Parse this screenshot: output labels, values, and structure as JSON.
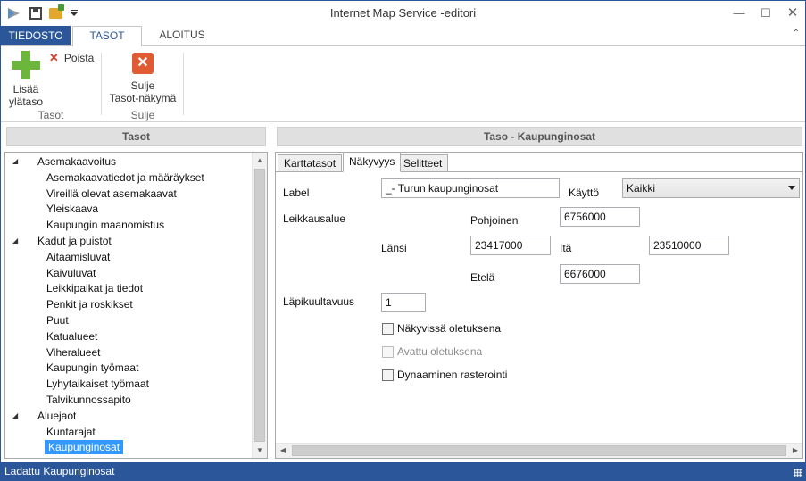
{
  "window": {
    "title": "Internet Map Service -editori",
    "controls": {
      "minimize": "—",
      "maximize": "☐",
      "close": "✕"
    }
  },
  "ribbon": {
    "file_tab": "TIEDOSTO",
    "tabs": [
      "TASOT",
      "ALOITUS"
    ],
    "active_tab": "TASOT",
    "collapse_glyph": "⌃",
    "add_button": "Lisää ylätaso",
    "remove_button": "Poista",
    "group_tasot": "Tasot",
    "close_button": "Sulje Tasot-näkymä",
    "group_sulje": "Sulje",
    "close_glyph": "✕"
  },
  "left_panel": {
    "header": "Tasot",
    "tree": [
      {
        "label": "Asemakaavoitus",
        "level": 0,
        "expanded": true
      },
      {
        "label": "Asemakaavatiedot ja määräykset",
        "level": 1
      },
      {
        "label": "Vireillä olevat asemakaavat",
        "level": 1
      },
      {
        "label": "Yleiskaava",
        "level": 1
      },
      {
        "label": "Kaupungin maanomistus",
        "level": 1
      },
      {
        "label": "Kadut ja puistot",
        "level": 0,
        "expanded": true
      },
      {
        "label": "Aitaamisluvat",
        "level": 1
      },
      {
        "label": "Kaivuluvat",
        "level": 1
      },
      {
        "label": "Leikkipaikat ja tiedot",
        "level": 1
      },
      {
        "label": "Penkit ja roskikset",
        "level": 1
      },
      {
        "label": "Puut",
        "level": 1
      },
      {
        "label": "Katualueet",
        "level": 1
      },
      {
        "label": "Viheralueet",
        "level": 1
      },
      {
        "label": "Kaupungin työmaat",
        "level": 1
      },
      {
        "label": "Lyhytaikaiset työmaat",
        "level": 1
      },
      {
        "label": "Talvikunnossapito",
        "level": 1
      },
      {
        "label": "Aluejaot",
        "level": 0,
        "expanded": true
      },
      {
        "label": "Kuntarajat",
        "level": 1
      },
      {
        "label": "Kaupunginosat",
        "level": 1,
        "selected": true
      }
    ]
  },
  "right_panel": {
    "header": "Taso - Kaupunginosat",
    "tabs": [
      "Karttatasot",
      "Näkyvyys",
      "Selitteet"
    ],
    "active_tab": "Näkyvyys",
    "form": {
      "label_caption": "Label",
      "label_value": "_- Turun kaupunginosat",
      "usage_caption": "Käyttö",
      "usage_value": "Kaikki",
      "clip_caption": "Leikkausalue",
      "north_caption": "Pohjoinen",
      "north_value": "6756000",
      "west_caption": "Länsi",
      "west_value": "23417000",
      "east_caption": "Itä",
      "east_value": "23510000",
      "south_caption": "Etelä",
      "south_value": "6676000",
      "opacity_caption": "Läpikuultavuus",
      "opacity_value": "1",
      "visible_default": "Näkyvissä oletuksena",
      "open_default": "Avattu oletuksena",
      "dynamic_raster": "Dynaaminen rasterointi"
    }
  },
  "status": {
    "text": "Ladattu Kaupunginosat"
  },
  "colors": {
    "accent": "#2b579a",
    "selection": "#3399ff",
    "add_green": "#6cb63b",
    "close_red": "#e05a32"
  }
}
